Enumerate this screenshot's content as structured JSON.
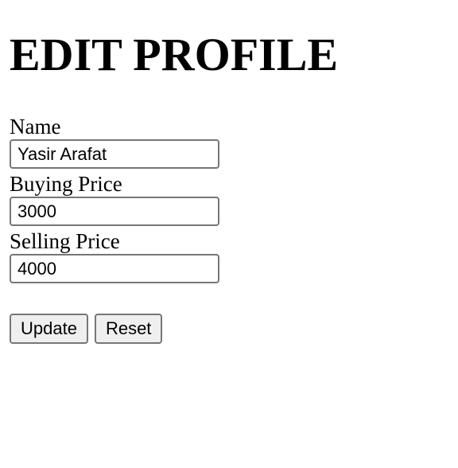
{
  "page": {
    "title": "EDIT PROFILE"
  },
  "form": {
    "fields": [
      {
        "label": "Name",
        "value": "Yasir Arafat"
      },
      {
        "label": "Buying Price",
        "value": "3000"
      },
      {
        "label": "Selling Price",
        "value": "4000"
      }
    ],
    "update_label": "Update",
    "reset_label": "Reset"
  }
}
